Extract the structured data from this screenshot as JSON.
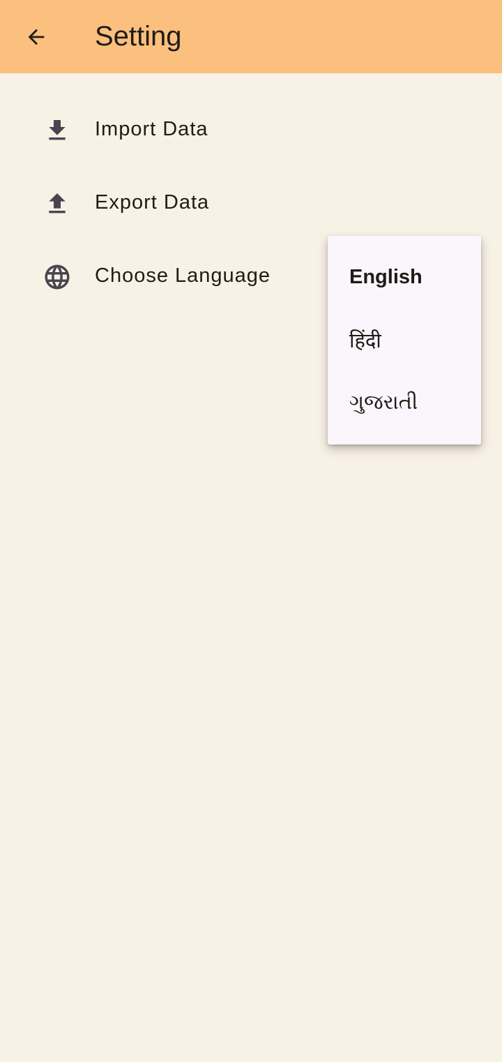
{
  "app_bar": {
    "title": "Setting",
    "back_icon": "arrow-back-icon",
    "background_color": "#fbbf7e"
  },
  "settings": {
    "items": [
      {
        "label": "Import Data",
        "icon": "download-icon"
      },
      {
        "label": "Export Data",
        "icon": "upload-icon"
      },
      {
        "label": "Choose Language",
        "icon": "globe-icon"
      }
    ]
  },
  "language_menu": {
    "selected": "English",
    "options": [
      {
        "label": "English"
      },
      {
        "label": "हिंदी"
      },
      {
        "label": "ગુજરાતી"
      }
    ]
  },
  "colors": {
    "page_background": "#f8f1e6",
    "menu_background": "#fbf5fc",
    "icon_color": "#49454f"
  }
}
